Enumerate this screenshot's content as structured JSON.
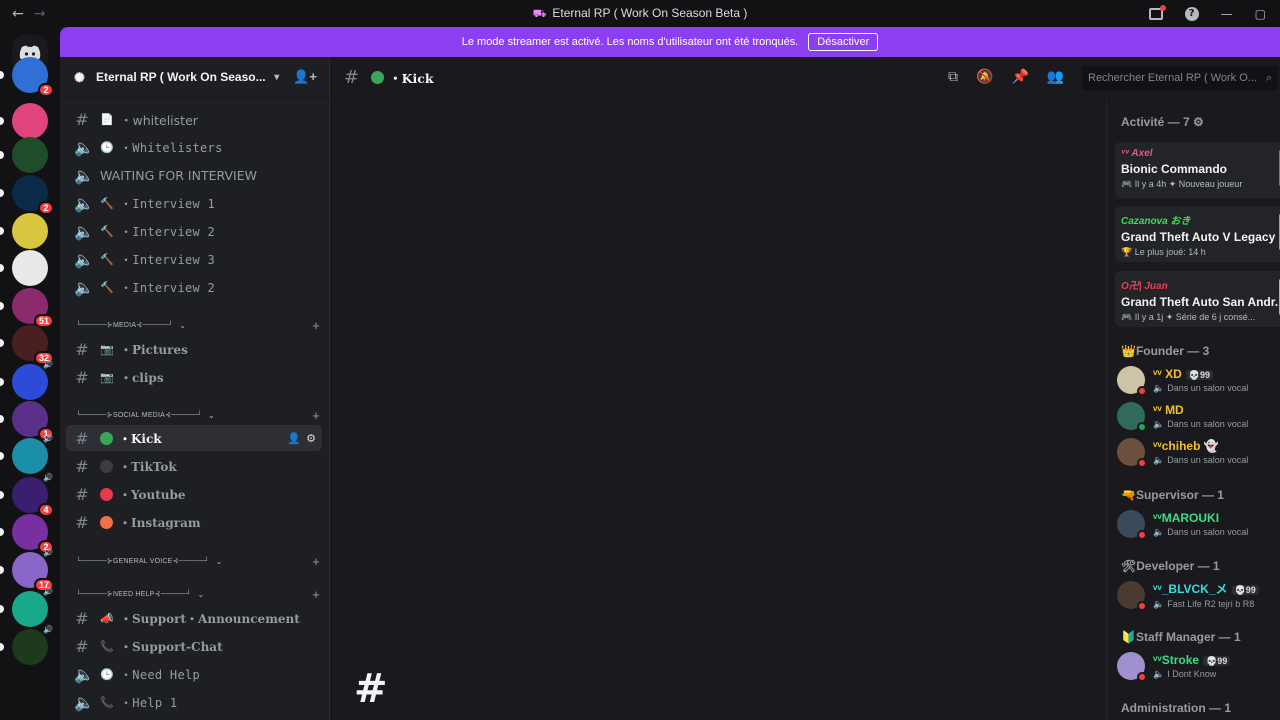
{
  "window": {
    "title": "Eternal RP ( Work On Season Beta )",
    "back": "←",
    "forward": "→",
    "help": "?",
    "minimize": "—",
    "maximize": "▢"
  },
  "banner": {
    "text": "Le mode streamer est activé. Les noms d'utilisateur ont été tronqués.",
    "button": "Désactiver"
  },
  "guilds": [
    {
      "badge": "2",
      "color": "#2f6fd6",
      "speaker": ""
    },
    {
      "badge": "",
      "color": "#e0447c",
      "speaker": ""
    },
    {
      "badge": "",
      "color": "#1f4d2a",
      "speaker": ""
    },
    {
      "badge": "2",
      "color": "#0b2a4a",
      "speaker": ""
    },
    {
      "badge": "",
      "color": "#d9c640",
      "speaker": ""
    },
    {
      "badge": "",
      "color": "#e8e8e8",
      "speaker": ""
    },
    {
      "badge": "51",
      "color": "#8c2a6e",
      "speaker": ""
    },
    {
      "badge": "32",
      "color": "#4a1f22",
      "speaker": ""
    },
    {
      "badge": "",
      "color": "#2c4bd8",
      "speaker": "🔊"
    },
    {
      "badge": "1",
      "color": "#5a2f8a",
      "speaker": ""
    },
    {
      "badge": "",
      "color": "#1b8fa8",
      "speaker": "🔊"
    },
    {
      "badge": "4",
      "color": "#3b1f6e",
      "speaker": "🔊"
    },
    {
      "badge": "2",
      "color": "#7a2fa0",
      "speaker": ""
    },
    {
      "badge": "17",
      "color": "#8a66c8",
      "speaker": "🔊"
    },
    {
      "badge": "",
      "color": "#1aa88a",
      "speaker": "🔊"
    },
    {
      "badge": "",
      "color": "#1d3a1d",
      "speaker": "🔊"
    }
  ],
  "server": {
    "name": "Eternal RP ( Work On Seaso...",
    "search_placeholder": "Rechercher Eternal RP ( Work O..."
  },
  "channels": [
    {
      "kind": "text",
      "emoji": "📄",
      "label": "・whitelister",
      "style": "plain"
    },
    {
      "kind": "voice",
      "emoji": "🕒",
      "label": "・Whitelisters",
      "style": "mono"
    },
    {
      "kind": "voice",
      "emoji": "",
      "label": "WAITING FOR INTERVIEW",
      "style": "plain"
    },
    {
      "kind": "voice",
      "emoji": "🔨",
      "label": "・Interview 1",
      "style": "mono"
    },
    {
      "kind": "voice",
      "emoji": "🔨",
      "label": "・Interview 2",
      "style": "mono"
    },
    {
      "kind": "voice",
      "emoji": "🔨",
      "label": "・Interview 3",
      "style": "mono"
    },
    {
      "kind": "voice",
      "emoji": "🔨",
      "label": "・Interview 2",
      "style": "mono"
    }
  ],
  "categories": {
    "media": "└─────⊱MEDIA⊰─────┘",
    "social": "└─────⊱SOCIAL MEDIA⊰─────┘",
    "general_voice": "└─────⊱GENERAL VOICE⊰─────┘",
    "need_help": "└─────⊱NEED HELP⊰─────┘"
  },
  "media_channels": [
    {
      "label": "・Pictures"
    },
    {
      "label": "・clips"
    }
  ],
  "social_channels": [
    {
      "label": "・Kick",
      "dot": "#3ba55c"
    },
    {
      "label": "・TikTok",
      "dot": "#3c3d44"
    },
    {
      "label": "・Youtube",
      "dot": "#e23b4a"
    },
    {
      "label": "・Instagram",
      "dot": "#f0704a"
    }
  ],
  "help_channels": [
    {
      "kind": "text",
      "emoji": "📣",
      "label": "・Support・Announcement"
    },
    {
      "kind": "text",
      "emoji": "📞",
      "label": "・Support-Chat"
    },
    {
      "kind": "voice",
      "emoji": "🕒",
      "label": "・Need Help"
    },
    {
      "kind": "voice",
      "emoji": "📞",
      "label": "・Help 1"
    }
  ],
  "topbar": {
    "channel": "・Kick"
  },
  "activity": {
    "header": "Activité — 7 ⚙",
    "cards": [
      {
        "user": "ᵛᵛ Axel",
        "user_color": "#e05a8a",
        "game": "Bionic Commando",
        "meta": "🎮 Il y a 4h  ✦ Nouveau joueur",
        "thumb": "#4a8a9a"
      },
      {
        "user": "Cazanova おき",
        "user_color": "#3ddc5a",
        "game": "Grand Theft Auto V Legacy",
        "meta": "🏆 Le plus joué: 14 h",
        "thumb": "#9aa0a6"
      },
      {
        "user": "O卍| Juan",
        "user_color": "#e0445a",
        "game": "Grand Theft Auto San Andr...",
        "meta": "🎮 Il y a 1j  ✦ Série de 6 j consé...",
        "thumb": "#c8b070"
      }
    ]
  },
  "roles": [
    {
      "header": "👑Founder — 3",
      "members": [
        {
          "name": "ᵛᵛ XD",
          "color": "#f0c030",
          "tag": "💀99",
          "status": "Dans un salon vocal",
          "av": "#cfc3a6"
        },
        {
          "name": "ᵛᵛ MD",
          "color": "#f0c030",
          "tag": "",
          "status": "Dans un salon vocal",
          "av": "#2f6a5a"
        },
        {
          "name": "ᵛᵛchiheb 👻",
          "color": "#f0c030",
          "tag": "",
          "status": "Dans un salon vocal",
          "av": "#6b5040"
        }
      ]
    },
    {
      "header": "🔫Supervisor — 1",
      "members": [
        {
          "name": "ᵛᵛMAROUKI",
          "color": "#3ddc84",
          "tag": "",
          "status": "Dans un salon vocal",
          "av": "#3a4a5a"
        }
      ]
    },
    {
      "header": "🛠Developer — 1",
      "members": [
        {
          "name": "ᵛᵛ_BLVCK_メ",
          "color": "#3ddcdc",
          "tag": "💀99",
          "status": "Fast Life R2 tejri b R8",
          "av": "#4a3a30"
        }
      ]
    },
    {
      "header": "🔰Staff Manager — 1",
      "members": [
        {
          "name": "ᵛᵛStroke",
          "color": "#3ddc84",
          "tag": "💀99",
          "status": "I Dont Know",
          "av": "#a090d0"
        }
      ]
    },
    {
      "header": "Administration — 1",
      "members": []
    }
  ]
}
